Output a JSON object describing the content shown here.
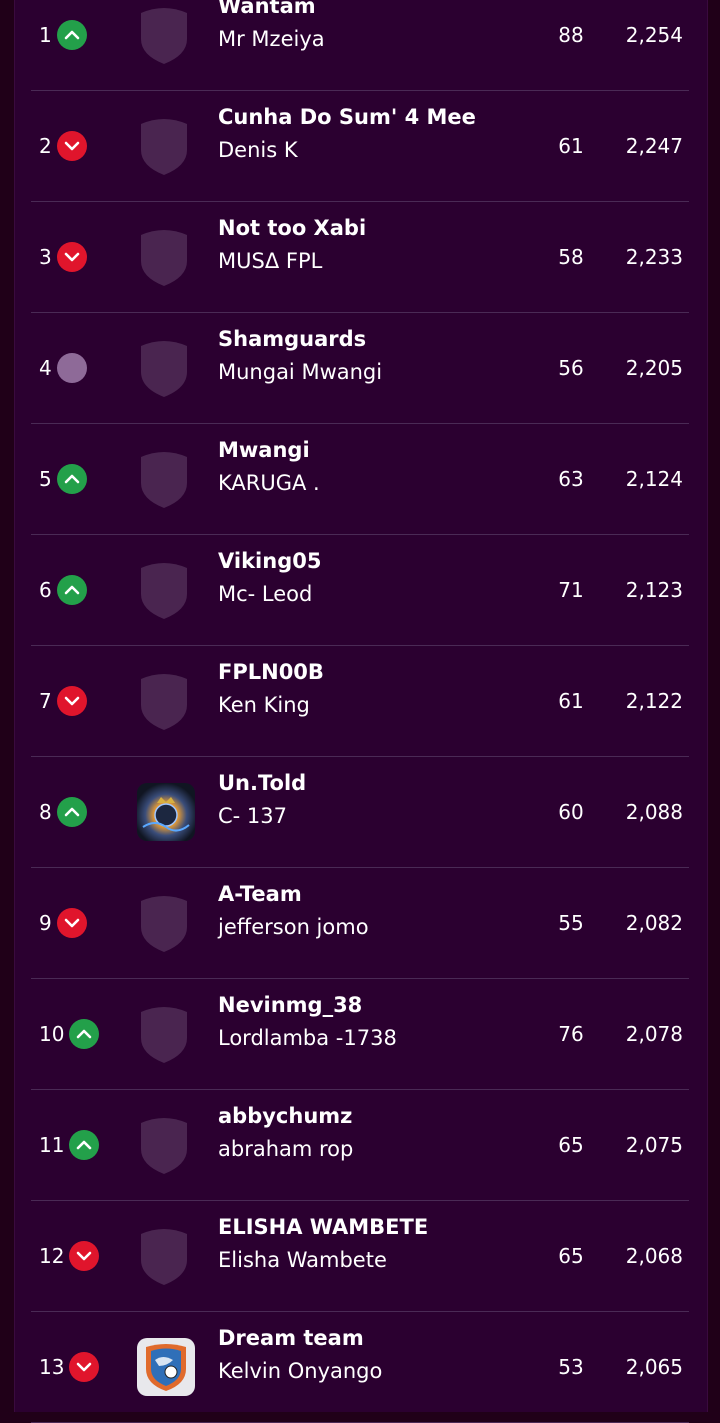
{
  "colors": {
    "background": "#200018",
    "panel": "#2b0030",
    "divider": "#4a2a55",
    "up": "#23a04a",
    "down": "#e0152c",
    "same": "#8e6a98",
    "badge": "#4a2550"
  },
  "standings": [
    {
      "rank": "1",
      "movement": "up",
      "team": "Wantam",
      "manager": "Mr Mzeiya",
      "gw_points": "88",
      "total": "2,254",
      "crest": "default-badge"
    },
    {
      "rank": "2",
      "movement": "down",
      "team": "Cunha Do Sum' 4 Mee",
      "manager": "Denis K",
      "gw_points": "61",
      "total": "2,247",
      "crest": "default-badge"
    },
    {
      "rank": "3",
      "movement": "down",
      "team": "Not too Xabi",
      "manager": "MUSΔ FPL",
      "gw_points": "58",
      "total": "2,233",
      "crest": "default-badge"
    },
    {
      "rank": "4",
      "movement": "same",
      "team": "Shamguards",
      "manager": "Mungai Mwangi",
      "gw_points": "56",
      "total": "2,205",
      "crest": "default-badge"
    },
    {
      "rank": "5",
      "movement": "up",
      "team": "Mwangi",
      "manager": "KARUGA .",
      "gw_points": "63",
      "total": "2,124",
      "crest": "default-badge"
    },
    {
      "rank": "6",
      "movement": "up",
      "team": "Viking05",
      "manager": "Mc- Leod",
      "gw_points": "71",
      "total": "2,123",
      "crest": "default-badge"
    },
    {
      "rank": "7",
      "movement": "down",
      "team": "FPLN00B",
      "manager": "Ken King",
      "gw_points": "61",
      "total": "2,122",
      "crest": "default-badge"
    },
    {
      "rank": "8",
      "movement": "up",
      "team": "Un.Told",
      "manager": "C- 137",
      "gw_points": "60",
      "total": "2,088",
      "crest": "custom-avatar-fireball"
    },
    {
      "rank": "9",
      "movement": "down",
      "team": "A-Team",
      "manager": "jefferson jomo",
      "gw_points": "55",
      "total": "2,082",
      "crest": "default-badge"
    },
    {
      "rank": "10",
      "movement": "up",
      "team": "Nevinmg_38",
      "manager": "Lordlamba -1738",
      "gw_points": "76",
      "total": "2,078",
      "crest": "default-badge"
    },
    {
      "rank": "11",
      "movement": "up",
      "team": "abbychumz",
      "manager": "abraham rop",
      "gw_points": "65",
      "total": "2,075",
      "crest": "default-badge"
    },
    {
      "rank": "12",
      "movement": "down",
      "team": "ELISHA WAMBETE",
      "manager": "Elisha Wambete",
      "gw_points": "65",
      "total": "2,068",
      "crest": "default-badge"
    },
    {
      "rank": "13",
      "movement": "down",
      "team": "Dream team",
      "manager": "Kelvin Onyango",
      "gw_points": "53",
      "total": "2,065",
      "crest": "custom-avatar-shield"
    }
  ]
}
